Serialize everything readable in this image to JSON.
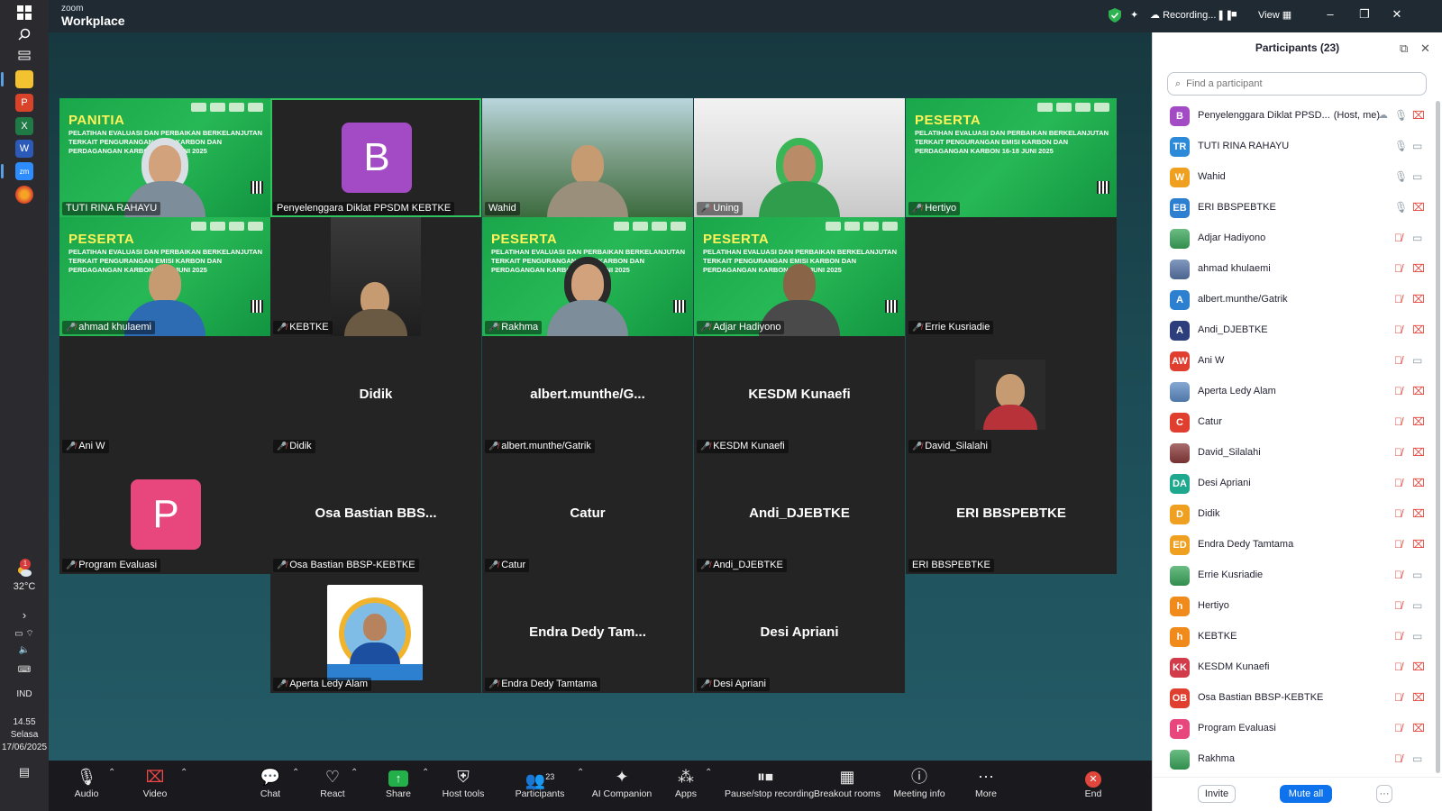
{
  "taskbar": {
    "weather_temp": "32°C",
    "weather_badge": "1",
    "language": "IND",
    "time": "14.55",
    "day": "Selasa",
    "date": "17/06/2025"
  },
  "titlebar": {
    "brand_small": "zoom",
    "brand_big": "Workplace",
    "recording": "Recording...",
    "view": "View"
  },
  "banner": {
    "panitia": "PANITIA",
    "peserta": "PESERTA",
    "subtitle": "PELATIHAN EVALUASI DAN PERBAIKAN BERKELANJUTAN TERKAIT PENGURANGAN EMISI KARBON DAN PERDAGANGAN KARBON",
    "dates": "16-18 JUNI 2025"
  },
  "tiles": {
    "t1": "TUTI RINA RAHAYU",
    "t2": "Penyelenggara Diklat PPSDM KEBTKE",
    "t2_initial": "B",
    "t3": "Wahid",
    "t4": "Uning",
    "t5": "Hertiyo",
    "t6": "ahmad khulaemi",
    "t7": "KEBTKE",
    "t8": "Rakhma",
    "t9": "Adjar Hadiyono",
    "t10": "Errie Kusriadie",
    "t11": "Ani W",
    "t12": "Didik",
    "t12_big": "Didik",
    "t13": "albert.munthe/Gatrik",
    "t13_big": "albert.munthe/G...",
    "t14": "KESDM Kunaefi",
    "t14_big": "KESDM Kunaefi",
    "t15": "David_Silalahi",
    "t16": "Program Evaluasi",
    "t16_initial": "P",
    "t17": "Osa Bastian BBSP-KEBTKE",
    "t17_big": "Osa Bastian BBS...",
    "t18": "Catur",
    "t18_big": "Catur",
    "t19": "Andi_DJEBTKE",
    "t19_big": "Andi_DJEBTKE",
    "t20": "ERI BBSPEBTKE",
    "t20_big": "ERI BBSPEBTKE",
    "t21": "Aperta Ledy Alam",
    "t22": "Endra Dedy Tamtama",
    "t22_big": "Endra Dedy Tam...",
    "t23": "Desi Apriani",
    "t23_big": "Desi Apriani"
  },
  "panel": {
    "title": "Participants (23)",
    "search_placeholder": "Find a participant",
    "host_suffix": "(Host, me)",
    "invite": "Invite",
    "mute_all": "Mute all",
    "more": "···",
    "participants": [
      {
        "initials": "B",
        "name": "Penyelenggara Diklat PPSD...",
        "color": "#a34bc4",
        "mic": "on",
        "video": "off",
        "host": true
      },
      {
        "initials": "TR",
        "name": "TUTI RINA RAHAYU",
        "color": "#2d8ad8",
        "mic": "on",
        "video": "on"
      },
      {
        "initials": "W",
        "name": "Wahid",
        "color": "#f0a020",
        "mic": "on",
        "video": "on"
      },
      {
        "initials": "EB",
        "name": "ERI BBSPEBTKE",
        "color": "#2d7fd0",
        "mic": "on",
        "video": "off"
      },
      {
        "initials": "",
        "name": "Adjar Hadiyono",
        "color": "#3aa65a",
        "mic": "off",
        "video": "on"
      },
      {
        "initials": "",
        "name": "ahmad khulaemi",
        "color": "#5876a8",
        "mic": "off",
        "video": "off"
      },
      {
        "initials": "A",
        "name": "albert.munthe/Gatrik",
        "color": "#2d7fd0",
        "mic": "off",
        "video": "off"
      },
      {
        "initials": "A",
        "name": "Andi_DJEBTKE",
        "color": "#2c3f7c",
        "mic": "off",
        "video": "off"
      },
      {
        "initials": "AW",
        "name": "Ani W",
        "color": "#e03e2e",
        "mic": "off",
        "video": "on"
      },
      {
        "initials": "",
        "name": "Aperta Ledy Alam",
        "color": "#5d8bc4",
        "mic": "off",
        "video": "off"
      },
      {
        "initials": "C",
        "name": "Catur",
        "color": "#e03e2e",
        "mic": "off",
        "video": "off"
      },
      {
        "initials": "",
        "name": "David_Silalahi",
        "color": "#8a3a3a",
        "mic": "off",
        "video": "off"
      },
      {
        "initials": "DA",
        "name": "Desi Apriani",
        "color": "#1ea98e",
        "mic": "off",
        "video": "off"
      },
      {
        "initials": "D",
        "name": "Didik",
        "color": "#f0a020",
        "mic": "off",
        "video": "off"
      },
      {
        "initials": "ED",
        "name": "Endra Dedy Tamtama",
        "color": "#f0a020",
        "mic": "off",
        "video": "off"
      },
      {
        "initials": "",
        "name": "Errie Kusriadie",
        "color": "#3aa65a",
        "mic": "off",
        "video": "on"
      },
      {
        "initials": "h",
        "name": "Hertiyo",
        "color": "#f08a1a",
        "mic": "off",
        "video": "on"
      },
      {
        "initials": "h",
        "name": "KEBTKE",
        "color": "#f08a1a",
        "mic": "off",
        "video": "on"
      },
      {
        "initials": "KK",
        "name": "KESDM Kunaefi",
        "color": "#d23c4a",
        "mic": "off",
        "video": "off"
      },
      {
        "initials": "OB",
        "name": "Osa Bastian BBSP-KEBTKE",
        "color": "#e03e2e",
        "mic": "off",
        "video": "off"
      },
      {
        "initials": "P",
        "name": "Program Evaluasi",
        "color": "#e8477e",
        "mic": "off",
        "video": "off"
      },
      {
        "initials": "",
        "name": "Rakhma",
        "color": "#3aa65a",
        "mic": "off",
        "video": "on"
      }
    ]
  },
  "toolbar": {
    "audio": "Audio",
    "video": "Video",
    "chat": "Chat",
    "react": "React",
    "share": "Share",
    "host_tools": "Host tools",
    "participants": "Participants",
    "participants_count": "23",
    "ai": "AI Companion",
    "apps": "Apps",
    "pause": "Pause/stop recording",
    "breakout": "Breakout rooms",
    "meeting_info": "Meeting info",
    "more": "More",
    "end": "End"
  },
  "colors": {
    "accent_blue": "#0e72ed",
    "active_speaker": "#32c45c",
    "mute_red": "#e0463c",
    "banner_green": "#1aa64a"
  }
}
